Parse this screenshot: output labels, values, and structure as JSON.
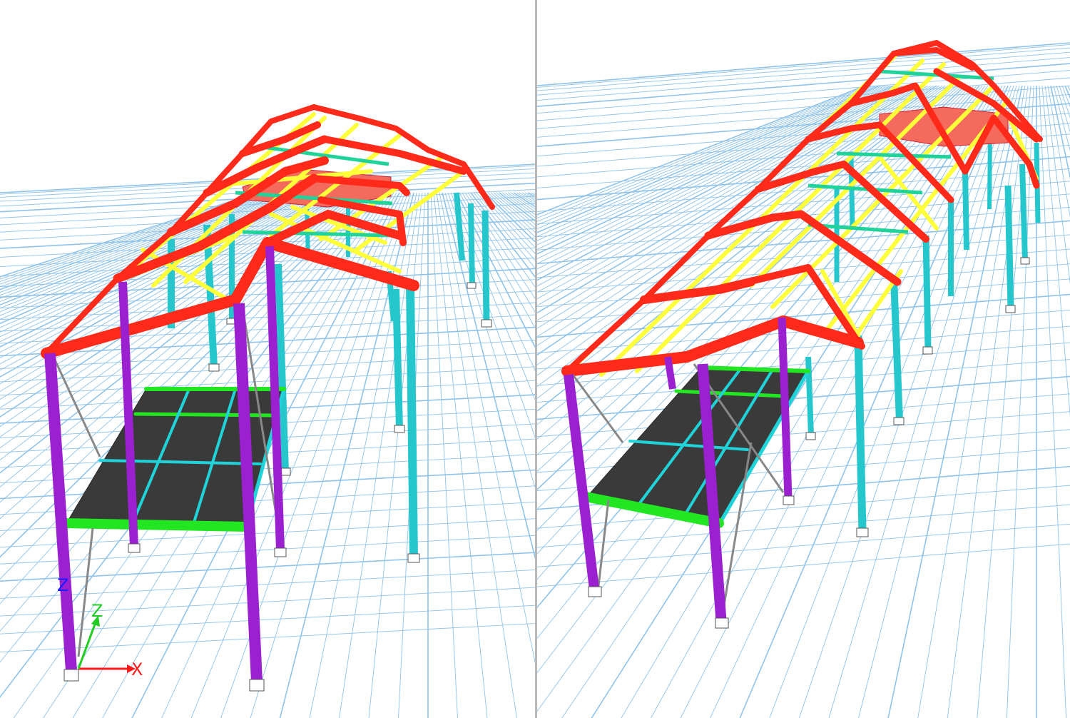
{
  "views": [
    {
      "id": "left",
      "label": ""
    },
    {
      "id": "right",
      "label": ""
    }
  ],
  "axes": {
    "z_global": "Z",
    "z_local": "Z",
    "x_local": "X"
  },
  "colors": {
    "background": "#ffffff",
    "grid": "#8fc3ea",
    "rafter": "#ff2a1a",
    "rafter_edge": "#9a3b36",
    "purlin": "#ffff3a",
    "column": "#26c7cc",
    "platform_column": "#9b20d0",
    "platform_beam_main": "#22e622",
    "platform_beam_secondary": "#1fd3d8",
    "deck": "#3a3a3a",
    "brace": "#888888",
    "ceiling_panel": "#f46a5c",
    "axis_x": "#ff1a1a",
    "axis_z": "#22cc22",
    "axis_z_global": "#1a1aff"
  }
}
